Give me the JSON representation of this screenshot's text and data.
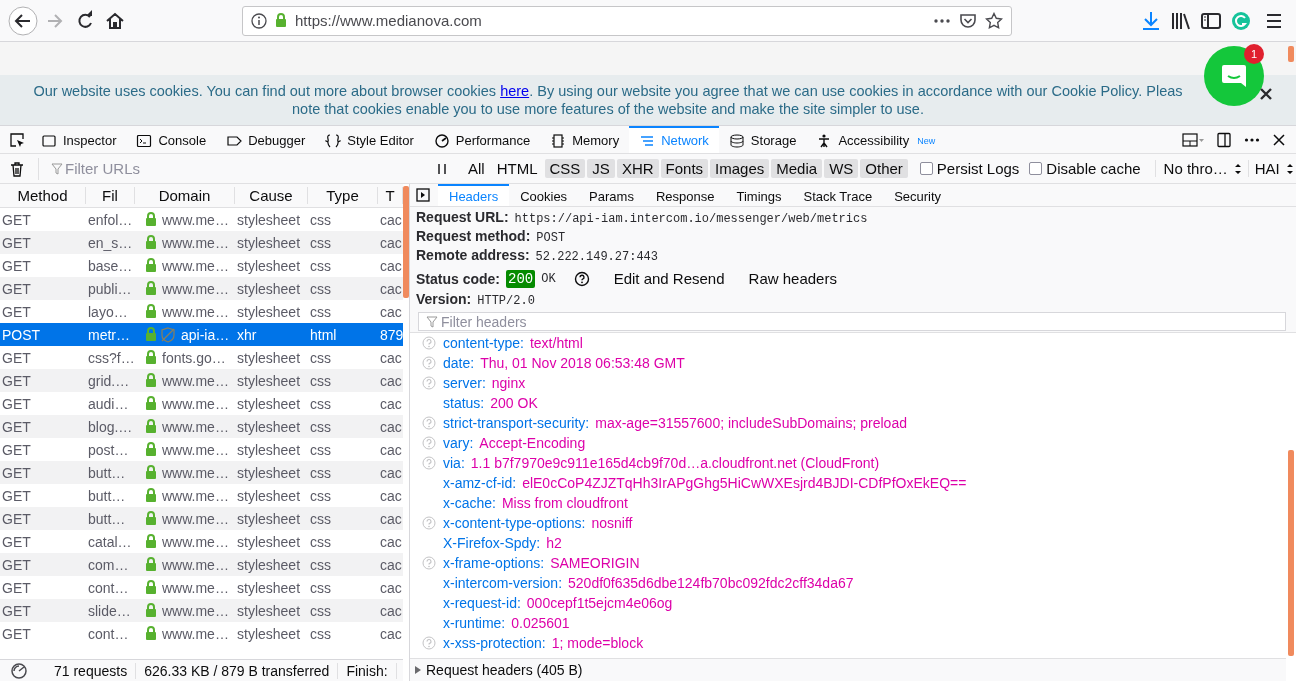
{
  "browser": {
    "url": "https://www.medianova.com"
  },
  "page": {
    "cookie_banner": {
      "text_before": "Our website uses cookies. You can find out more about browser cookies ",
      "link": "here",
      "text_after": ". By using our website you agree that we can use cookies in accordance with our Cookie Policy. Pleas",
      "line_2": "note that cookies enable you to use more features of the website and make the site simpler to use."
    },
    "chat_widget": {
      "badge": "1"
    }
  },
  "devtools": {
    "tabs": [
      {
        "label": "Inspector",
        "selected": false
      },
      {
        "label": "Console",
        "selected": false
      },
      {
        "label": "Debugger",
        "selected": false
      },
      {
        "label": "Style Editor",
        "selected": false
      },
      {
        "label": "Performance",
        "selected": false
      },
      {
        "label": "Memory",
        "selected": false
      },
      {
        "label": "Network",
        "selected": true
      },
      {
        "label": "Storage",
        "selected": false
      },
      {
        "label": "Accessibility",
        "selected": false,
        "badge": "New"
      }
    ]
  },
  "toolbar": {
    "filter": {
      "placeholder": "Filter URLs"
    },
    "type_filters": [
      {
        "label": "All",
        "selected": false
      },
      {
        "label": "HTML",
        "selected": false
      },
      {
        "label": "CSS",
        "selected": true
      },
      {
        "label": "JS",
        "selected": true
      },
      {
        "label": "XHR",
        "selected": true
      },
      {
        "label": "Fonts",
        "selected": true
      },
      {
        "label": "Images",
        "selected": true
      },
      {
        "label": "Media",
        "selected": true
      },
      {
        "label": "WS",
        "selected": true
      },
      {
        "label": "Other",
        "selected": true
      }
    ],
    "options": [
      {
        "label": "Persist Logs",
        "checked": false
      },
      {
        "label": "Disable cache",
        "checked": false
      }
    ],
    "throttling": "No thro…",
    "har": "HAI"
  },
  "requests": {
    "columns": [
      "Method",
      "Fil",
      "Domain",
      "Cause",
      "Type",
      "T"
    ],
    "rows": [
      {
        "method": "GET",
        "file": "enfol…",
        "domain": "www.me…",
        "cause": "stylesheet",
        "type": "css",
        "transferred": "cac",
        "selected": false,
        "tracker": false
      },
      {
        "method": "GET",
        "file": "en_s…",
        "domain": "www.me…",
        "cause": "stylesheet",
        "type": "css",
        "transferred": "cac",
        "selected": false,
        "tracker": false
      },
      {
        "method": "GET",
        "file": "base…",
        "domain": "www.me…",
        "cause": "stylesheet",
        "type": "css",
        "transferred": "cac",
        "selected": false,
        "tracker": false
      },
      {
        "method": "GET",
        "file": "publi…",
        "domain": "www.me…",
        "cause": "stylesheet",
        "type": "css",
        "transferred": "cac",
        "selected": false,
        "tracker": false
      },
      {
        "method": "GET",
        "file": "layo…",
        "domain": "www.me…",
        "cause": "stylesheet",
        "type": "css",
        "transferred": "cac",
        "selected": false,
        "tracker": false
      },
      {
        "method": "POST",
        "file": "metr…",
        "domain": "api-ia…",
        "cause": "xhr",
        "type": "html",
        "transferred": "879",
        "selected": true,
        "tracker": true
      },
      {
        "method": "GET",
        "file": "css?f…",
        "domain": "fonts.go…",
        "cause": "stylesheet",
        "type": "css",
        "transferred": "cac",
        "selected": false,
        "tracker": false
      },
      {
        "method": "GET",
        "file": "grid.…",
        "domain": "www.me…",
        "cause": "stylesheet",
        "type": "css",
        "transferred": "cac",
        "selected": false,
        "tracker": false
      },
      {
        "method": "GET",
        "file": "audi…",
        "domain": "www.me…",
        "cause": "stylesheet",
        "type": "css",
        "transferred": "cac",
        "selected": false,
        "tracker": false
      },
      {
        "method": "GET",
        "file": "blog.…",
        "domain": "www.me…",
        "cause": "stylesheet",
        "type": "css",
        "transferred": "cac",
        "selected": false,
        "tracker": false
      },
      {
        "method": "GET",
        "file": "post…",
        "domain": "www.me…",
        "cause": "stylesheet",
        "type": "css",
        "transferred": "cac",
        "selected": false,
        "tracker": false
      },
      {
        "method": "GET",
        "file": "butt…",
        "domain": "www.me…",
        "cause": "stylesheet",
        "type": "css",
        "transferred": "cac",
        "selected": false,
        "tracker": false
      },
      {
        "method": "GET",
        "file": "butt…",
        "domain": "www.me…",
        "cause": "stylesheet",
        "type": "css",
        "transferred": "cac",
        "selected": false,
        "tracker": false
      },
      {
        "method": "GET",
        "file": "butt…",
        "domain": "www.me…",
        "cause": "stylesheet",
        "type": "css",
        "transferred": "cac",
        "selected": false,
        "tracker": false
      },
      {
        "method": "GET",
        "file": "catal…",
        "domain": "www.me…",
        "cause": "stylesheet",
        "type": "css",
        "transferred": "cac",
        "selected": false,
        "tracker": false
      },
      {
        "method": "GET",
        "file": "com…",
        "domain": "www.me…",
        "cause": "stylesheet",
        "type": "css",
        "transferred": "cac",
        "selected": false,
        "tracker": false
      },
      {
        "method": "GET",
        "file": "cont…",
        "domain": "www.me…",
        "cause": "stylesheet",
        "type": "css",
        "transferred": "cac",
        "selected": false,
        "tracker": false
      },
      {
        "method": "GET",
        "file": "slide…",
        "domain": "www.me…",
        "cause": "stylesheet",
        "type": "css",
        "transferred": "cac",
        "selected": false,
        "tracker": false
      },
      {
        "method": "GET",
        "file": "cont…",
        "domain": "www.me…",
        "cause": "stylesheet",
        "type": "css",
        "transferred": "cac",
        "selected": false,
        "tracker": false
      }
    ]
  },
  "status_bar": {
    "requests": "71 requests",
    "transferred": "626.33 KB / 879 B transferred",
    "finish": "Finish:"
  },
  "details": {
    "tabs": [
      {
        "label": "Headers",
        "selected": true
      },
      {
        "label": "Cookies",
        "selected": false
      },
      {
        "label": "Params",
        "selected": false
      },
      {
        "label": "Response",
        "selected": false
      },
      {
        "label": "Timings",
        "selected": false
      },
      {
        "label": "Stack Trace",
        "selected": false
      },
      {
        "label": "Security",
        "selected": false
      }
    ],
    "summary": [
      {
        "label": "Request URL:",
        "value": "https://api-iam.intercom.io/messenger/web/metrics"
      },
      {
        "label": "Request method:",
        "value": "POST"
      },
      {
        "label": "Remote address:",
        "value": "52.222.149.27:443"
      }
    ],
    "status": {
      "label": "Status code:",
      "code": "200",
      "text": "OK",
      "actions": [
        "Edit and Resend",
        "Raw headers"
      ]
    },
    "version": {
      "label": "Version:",
      "value": "HTTP/2.0"
    },
    "filter": {
      "placeholder": "Filter headers"
    },
    "headers": [
      {
        "name": "content-type:",
        "value": "text/html",
        "help": true
      },
      {
        "name": "date:",
        "value": "Thu, 01 Nov 2018 06:53:48 GMT",
        "help": true
      },
      {
        "name": "server:",
        "value": "nginx",
        "help": true
      },
      {
        "name": "status:",
        "value": "200 OK",
        "help": false
      },
      {
        "name": "strict-transport-security:",
        "value": "max-age=31557600; includeSubDomains; preload",
        "help": true
      },
      {
        "name": "vary:",
        "value": "Accept-Encoding",
        "help": true
      },
      {
        "name": "via:",
        "value": "1.1 b7f7970e9c911e165d4cb9f70d…a.cloudfront.net (CloudFront)",
        "help": true
      },
      {
        "name": "x-amz-cf-id:",
        "value": "elE0cCoP4ZJZTqHh3IrAPgGhg5HiCwWXEsjrd4BJDI-CDfPfOxEkEQ==",
        "help": false
      },
      {
        "name": "x-cache:",
        "value": "Miss from cloudfront",
        "help": false
      },
      {
        "name": "x-content-type-options:",
        "value": "nosniff",
        "help": true
      },
      {
        "name": "X-Firefox-Spdy:",
        "value": "h2",
        "help": false
      },
      {
        "name": "x-frame-options:",
        "value": "SAMEORIGIN",
        "help": true
      },
      {
        "name": "x-intercom-version:",
        "value": "520df0f635d6dbe124fb70bc092fdc2cff34da67",
        "help": false
      },
      {
        "name": "x-request-id:",
        "value": "000cepf1t5ejcm4e06og",
        "help": false
      },
      {
        "name": "x-runtime:",
        "value": "0.025601",
        "help": false
      },
      {
        "name": "x-xss-protection:",
        "value": "1; mode=block",
        "help": true
      }
    ],
    "request_headers": {
      "label": "Request headers (405 B)",
      "expanded": false
    }
  }
}
